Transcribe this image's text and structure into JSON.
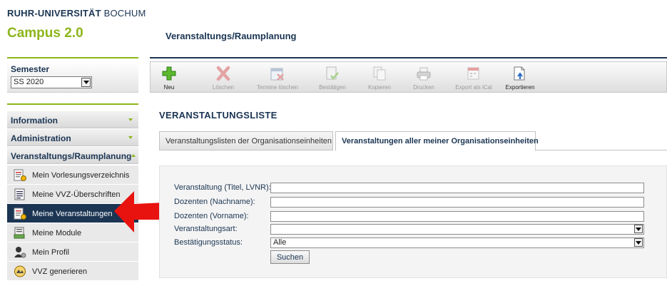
{
  "header": {
    "university_bold": "RUHR-UNIVERSITÄT",
    "university_thin": "BOCHUM",
    "campus": "Campus 2.0",
    "page_heading": "Veranstaltungs/Raumplanung"
  },
  "sidebar": {
    "semester_label": "Semester",
    "semester_value": "SS 2020",
    "sections": [
      {
        "label": "Information",
        "expanded": false
      },
      {
        "label": "Administration",
        "expanded": false
      },
      {
        "label": "Veranstaltungs/Raumplanung",
        "expanded": true
      }
    ],
    "items": [
      {
        "label": "Mein Vorlesungsverzeichnis",
        "icon": "course-catalog-icon"
      },
      {
        "label": "Meine VVZ-Überschriften",
        "icon": "document-list-icon"
      },
      {
        "label": "Meine Veranstaltungen",
        "icon": "my-courses-icon",
        "active": true
      },
      {
        "label": "Meine Module",
        "icon": "modules-icon"
      },
      {
        "label": "Mein Profil",
        "icon": "profile-icon"
      },
      {
        "label": "VVZ generieren",
        "icon": "generate-icon"
      }
    ]
  },
  "toolbar": {
    "buttons": [
      {
        "label": "Neu",
        "icon": "plus-icon",
        "enabled": true
      },
      {
        "label": "Löschen",
        "icon": "delete-x-icon",
        "enabled": false
      },
      {
        "label": "Termine löschen",
        "icon": "delete-dates-icon",
        "enabled": false
      },
      {
        "label": "Bestätigen",
        "icon": "confirm-icon",
        "enabled": false
      },
      {
        "label": "Kopieren",
        "icon": "copy-icon",
        "enabled": false
      },
      {
        "label": "Drucken",
        "icon": "print-icon",
        "enabled": false
      },
      {
        "label": "Export als iCal",
        "icon": "calendar-export-icon",
        "enabled": false
      },
      {
        "label": "Exportieren",
        "icon": "export-icon",
        "enabled": true
      }
    ]
  },
  "main": {
    "section_title": "VERANSTALTUNGSLISTE",
    "tabs": [
      {
        "label": "Veranstaltungslisten der Organisationseinheiten",
        "active": false
      },
      {
        "label": "Veranstaltungen aller meiner Organisationseinheiten",
        "active": true
      }
    ],
    "form": {
      "fields": [
        {
          "label": "Veranstaltung (Titel, LVNR):",
          "type": "text",
          "value": ""
        },
        {
          "label": "Dozenten (Nachname):",
          "type": "text",
          "value": ""
        },
        {
          "label": "Dozenten (Vorname):",
          "type": "text",
          "value": ""
        },
        {
          "label": "Veranstaltungsart:",
          "type": "select",
          "value": ""
        },
        {
          "label": "Bestätigungsstatus:",
          "type": "select",
          "value": "Alle"
        }
      ],
      "search_label": "Suchen"
    }
  },
  "colors": {
    "navy": "#1b3553",
    "green": "#8db51b",
    "highlight_arrow": "#e8130f"
  }
}
